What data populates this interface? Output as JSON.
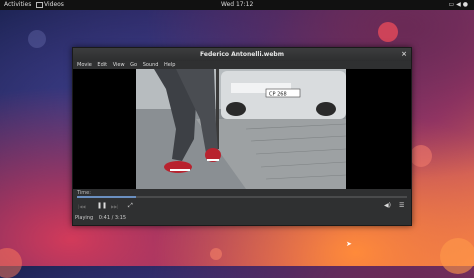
{
  "topbar": {
    "activities": "Activities",
    "app_name": "Videos",
    "clock": "Wed 17:12",
    "tray_icons": [
      "display-icon",
      "volume-icon",
      "user-icon"
    ]
  },
  "window": {
    "title": "Federico Antonelli.webm",
    "menu": [
      "Movie",
      "Edit",
      "View",
      "Go",
      "Sound",
      "Help"
    ]
  },
  "player": {
    "seek_label": "Time:",
    "progress_fraction": 0.18,
    "prev_label": "|◀◀",
    "play_pause_icon": "pause-icon",
    "next_label": "▶▶|",
    "fullscreen_icon": "fullscreen-icon",
    "volume_icon": "volume-icon",
    "menu_icon": "menu-icon",
    "status": "Playing",
    "position": "0:41 / 3:15"
  },
  "colors": {
    "accent": "#6a8fc0"
  }
}
